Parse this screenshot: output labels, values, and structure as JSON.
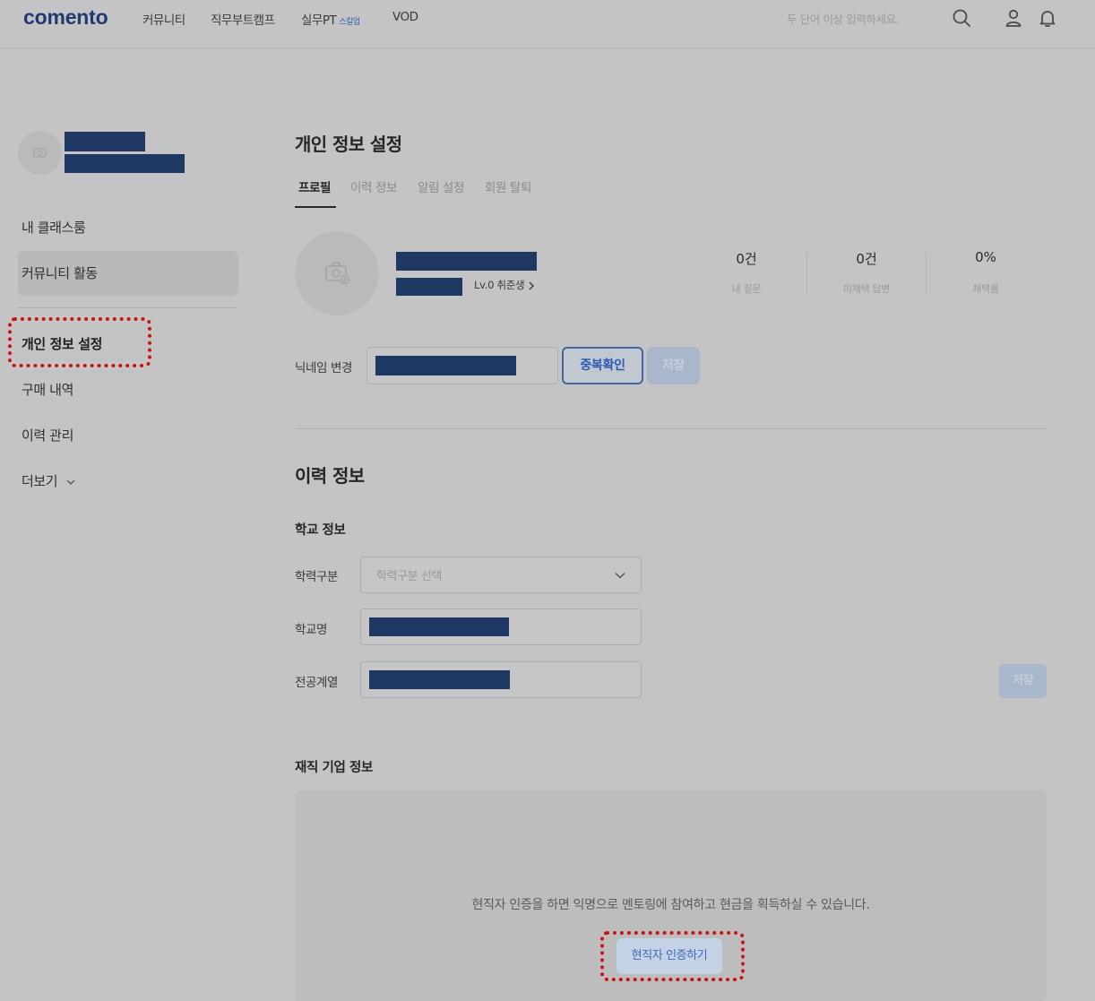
{
  "header": {
    "logo": "comento",
    "nav": [
      {
        "label": "커뮤니티"
      },
      {
        "label": "직무부트캠프"
      },
      {
        "label": "실무PT",
        "tag": "스킬업"
      },
      {
        "label": "VOD"
      }
    ],
    "search_placeholder": "두 단어 이상 입력하세요."
  },
  "sidebar": {
    "items": [
      {
        "label": "내 클래스룸"
      },
      {
        "label": "커뮤니티 활동"
      },
      {
        "label": "개인 정보 설정"
      },
      {
        "label": "구매 내역"
      },
      {
        "label": "이력 관리"
      },
      {
        "label": "더보기"
      }
    ]
  },
  "main": {
    "title": "개인 정보 설정",
    "tabs": [
      {
        "label": "프로필"
      },
      {
        "label": "이력 정보"
      },
      {
        "label": "알림 설정"
      },
      {
        "label": "회원 탈퇴"
      }
    ],
    "profile": {
      "level_link": "Lv.0 취준생"
    },
    "stats": [
      {
        "value": "0건",
        "label": "내 질문"
      },
      {
        "value": "0건",
        "label": "미채택 답변"
      },
      {
        "value": "0%",
        "label": "채택률"
      }
    ],
    "nickname": {
      "label": "닉네임 변경",
      "check_button": "중복확인",
      "save_button": "저장"
    },
    "career": {
      "title": "이력 정보",
      "school": {
        "title": "학교 정보",
        "degree_label": "학력구분",
        "degree_placeholder": "학력구분 선택",
        "school_label": "학교명",
        "major_label": "전공계열",
        "save_button": "저장"
      },
      "company": {
        "title": "재직 기업 정보",
        "message": "현직자 인증을 하면 익명으로 멘토링에 참여하고 현금을 획득하실 수 있습니다.",
        "verify_button": "현직자 인증하기"
      }
    }
  },
  "colors": {
    "brand": "#203a72",
    "accent": "#2b59b8",
    "highlight": "#d10e0e"
  }
}
